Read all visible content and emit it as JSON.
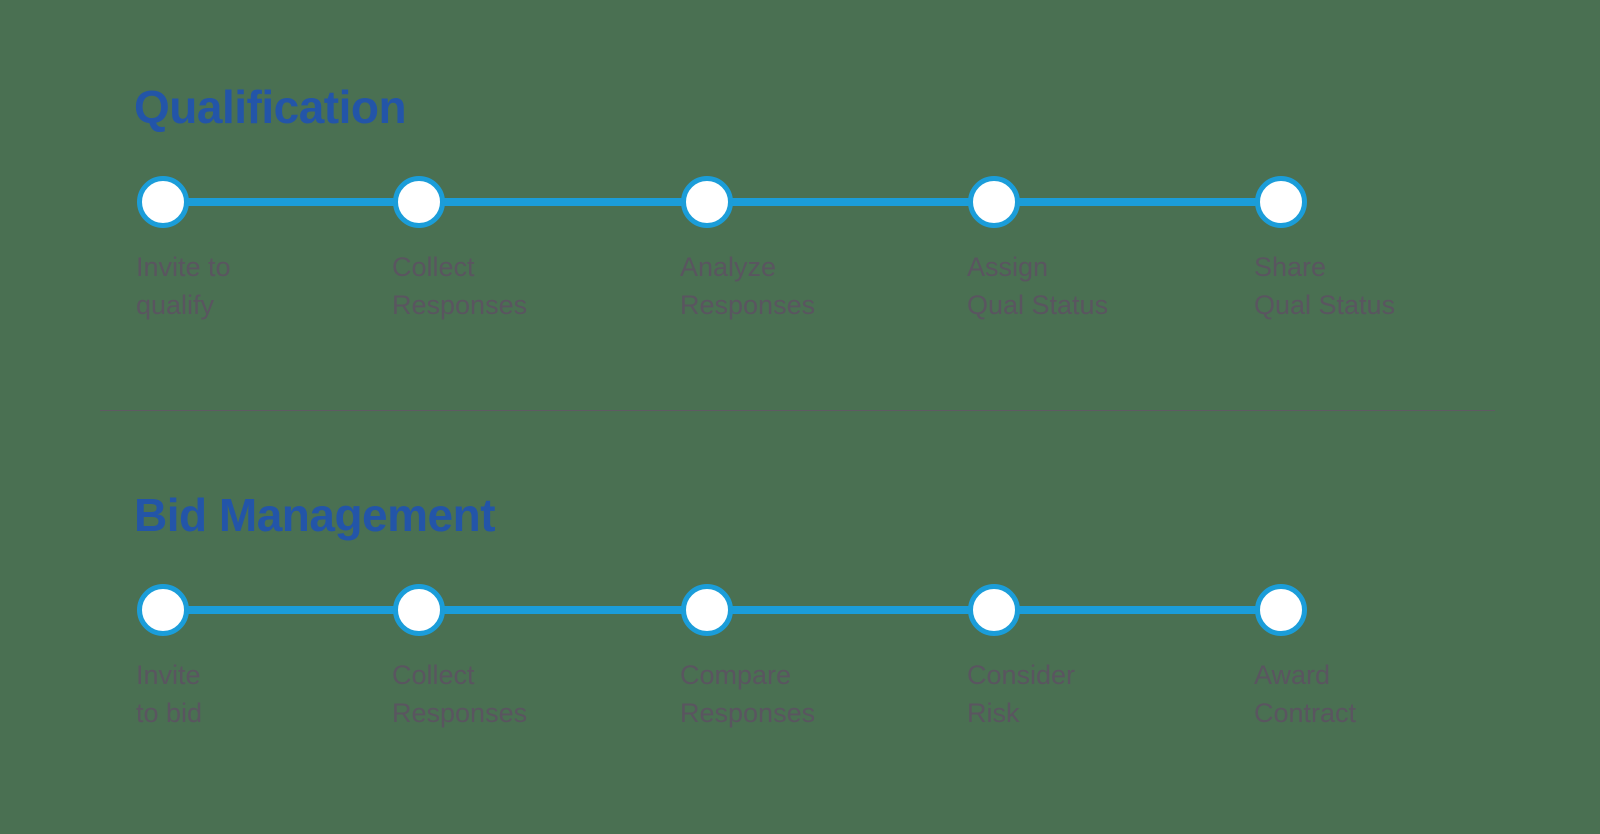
{
  "theme": {
    "background": "#4a7052",
    "title_color": "#2355a8",
    "accent": "#1b9dd9",
    "node_fill": "#ffffff",
    "label_color": "#5a5560",
    "divider_color": "#5f5a63"
  },
  "node_positions": [
    163,
    419,
    707,
    994,
    1281
  ],
  "sections": [
    {
      "id": "qualification",
      "title": "Qualification",
      "steps": [
        {
          "label": "Invite to\nqualify"
        },
        {
          "label": "Collect\nResponses"
        },
        {
          "label": "Analyze\nResponses"
        },
        {
          "label": "Assign\nQual Status"
        },
        {
          "label": "Share\nQual Status"
        }
      ]
    },
    {
      "id": "bid-management",
      "title": "Bid Management",
      "steps": [
        {
          "label": "Invite\nto bid"
        },
        {
          "label": "Collect\nResponses"
        },
        {
          "label": "Compare\nResponses"
        },
        {
          "label": "Consider\nRisk"
        },
        {
          "label": "Award\nContract"
        }
      ]
    }
  ]
}
